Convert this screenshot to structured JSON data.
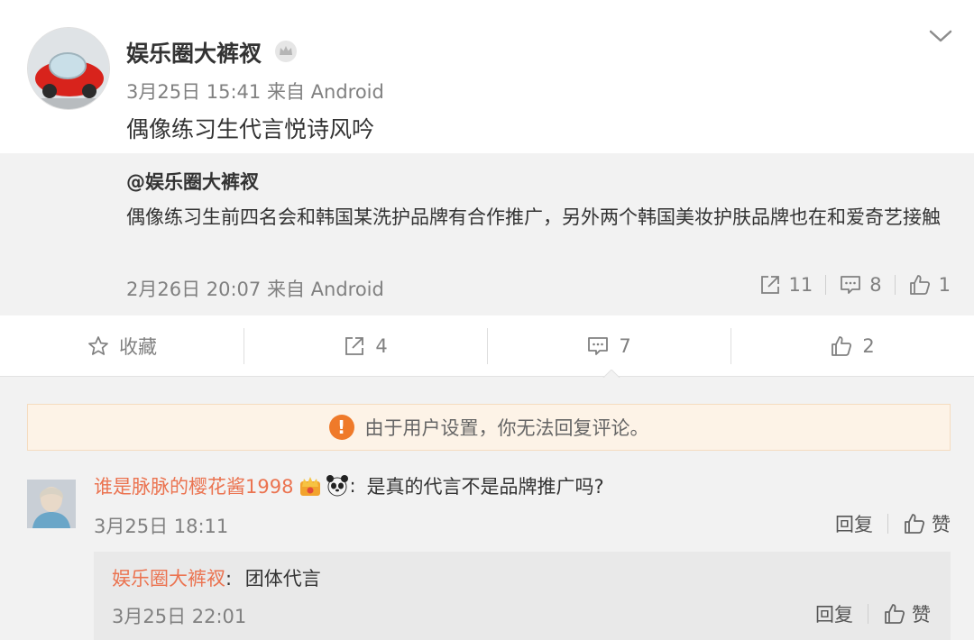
{
  "post": {
    "username": "娱乐圈大裤衩",
    "date": "3月25日 15:41",
    "source": "来自 Android",
    "text": "偶像练习生代言悦诗风吟"
  },
  "quoted": {
    "author": "@娱乐圈大裤衩",
    "text": "偶像练习生前四名会和韩国某洗护品牌有合作推广，另外两个韩国美妆护肤品牌也在和爱奇艺接触",
    "date": "2月26日 20:07",
    "source": "来自 Android",
    "reposts": "11",
    "comments": "8",
    "likes": "1"
  },
  "actions": {
    "favorite_label": "收藏",
    "repost_count": "4",
    "comment_count": "7",
    "like_count": "2"
  },
  "notice": {
    "text": "由于用户设置，你无法回复评论。",
    "icon_text": "!"
  },
  "comment": {
    "username": "谁是脉脉的樱花酱1998",
    "separator": ":",
    "text": "是真的代言不是品牌推广吗?",
    "time": "3月25日 18:11",
    "reply_label": "回复",
    "like_label": "赞"
  },
  "reply": {
    "username": "娱乐圈大裤衩",
    "separator": ":",
    "text": "团体代言",
    "time": "3月25日 22:01",
    "reply_label": "回复",
    "like_label": "赞"
  },
  "colors": {
    "username_accent": "#eb7350",
    "notice_icon": "#ef7a2a",
    "muted_text": "#808080"
  }
}
